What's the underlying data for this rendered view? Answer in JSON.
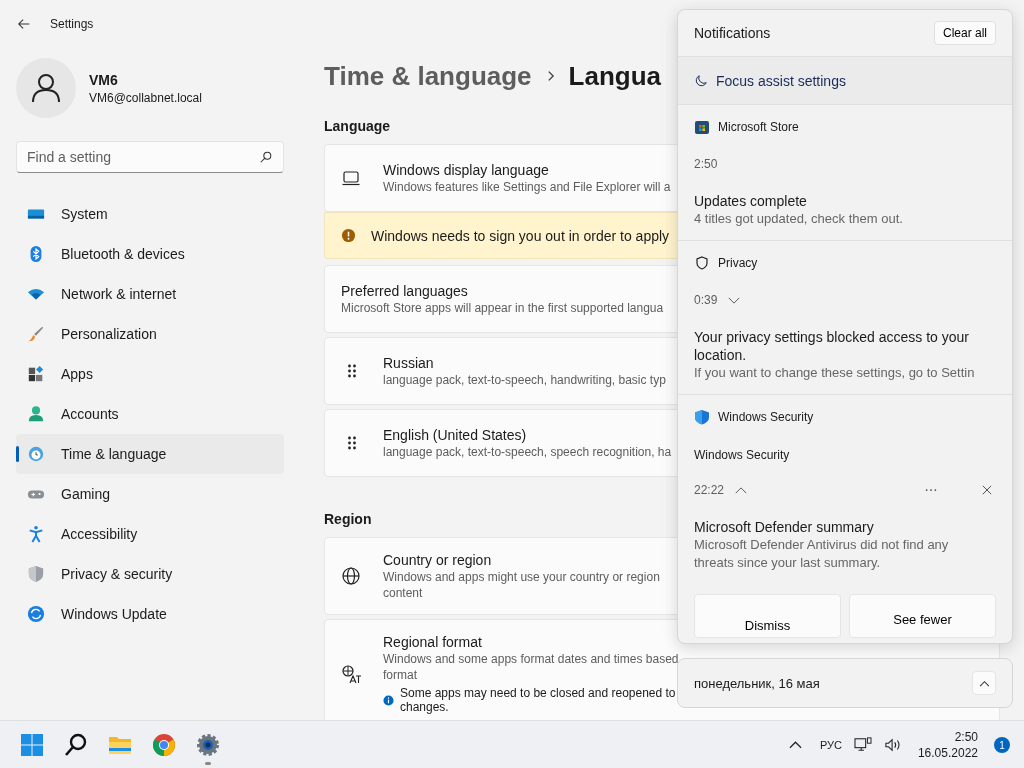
{
  "window": {
    "title": "Settings"
  },
  "user": {
    "name": "VM6",
    "email": "VM6@collabnet.local"
  },
  "search": {
    "placeholder": "Find a setting"
  },
  "nav": [
    {
      "label": "System",
      "selected": false
    },
    {
      "label": "Bluetooth & devices",
      "selected": false
    },
    {
      "label": "Network & internet",
      "selected": false
    },
    {
      "label": "Personalization",
      "selected": false
    },
    {
      "label": "Apps",
      "selected": false
    },
    {
      "label": "Accounts",
      "selected": false
    },
    {
      "label": "Time & language",
      "selected": true
    },
    {
      "label": "Gaming",
      "selected": false
    },
    {
      "label": "Accessibility",
      "selected": false
    },
    {
      "label": "Privacy & security",
      "selected": false
    },
    {
      "label": "Windows Update",
      "selected": false
    }
  ],
  "breadcrumb": {
    "parent": "Time & language",
    "current": "Langua"
  },
  "sections": [
    {
      "heading": "Language",
      "cards": [
        {
          "kind": "setting",
          "title": "Windows display language",
          "lines": [
            "Windows features like Settings and File Explorer will a"
          ]
        },
        {
          "kind": "warning",
          "text": "Windows needs to sign you out in order to apply"
        },
        {
          "kind": "plain",
          "title": "Preferred languages",
          "lines": [
            "Microsoft Store apps will appear in the first supported langua"
          ]
        },
        {
          "kind": "drag",
          "title": "Russian",
          "lines": [
            "language pack, text-to-speech, handwriting, basic typ"
          ]
        },
        {
          "kind": "drag",
          "title": "English (United States)",
          "lines": [
            "language pack, text-to-speech, speech recognition, ha"
          ]
        }
      ]
    },
    {
      "heading": "Region",
      "cards": [
        {
          "kind": "setting",
          "title": "Country or region",
          "lines": [
            "Windows and apps might use your country or region",
            "content"
          ]
        },
        {
          "kind": "setting",
          "title": "Regional format",
          "lines": [
            "Windows and some apps format dates and times based",
            "format"
          ],
          "note": [
            "Some apps may need to be closed and reopened to",
            "changes."
          ]
        }
      ]
    }
  ],
  "notifications": {
    "title": "Notifications",
    "clear_button": "Clear all",
    "focus_link": "Focus assist settings",
    "groups": [
      {
        "app": "Microsoft Store",
        "time": "2:50",
        "title": "Updates complete",
        "body": "4 titles got updated, check them out."
      },
      {
        "app": "Privacy",
        "time": "0:39",
        "expanded": false,
        "title": "Your privacy settings blocked access to your location.",
        "body": "If you want to change these settings, go to Settin"
      },
      {
        "app": "Windows Security",
        "header": "Windows Security",
        "time": "22:22",
        "expanded": true,
        "title": "Microsoft Defender summary",
        "body": "Microsoft Defender Antivirus did not find any threats since your last summary.",
        "buttons": [
          "Dismiss",
          "See fewer"
        ]
      }
    ]
  },
  "calendar": {
    "date": "понедельник, 16 мая"
  },
  "taskbar": {
    "apps": [
      {
        "kind": "start",
        "running": false
      },
      {
        "kind": "search",
        "running": false
      },
      {
        "kind": "explorer",
        "running": false
      },
      {
        "kind": "chrome",
        "running": false
      },
      {
        "kind": "settings",
        "running": true
      }
    ],
    "language": "РУС",
    "time": "2:50",
    "date": "16.05.2022",
    "badge": "1"
  }
}
